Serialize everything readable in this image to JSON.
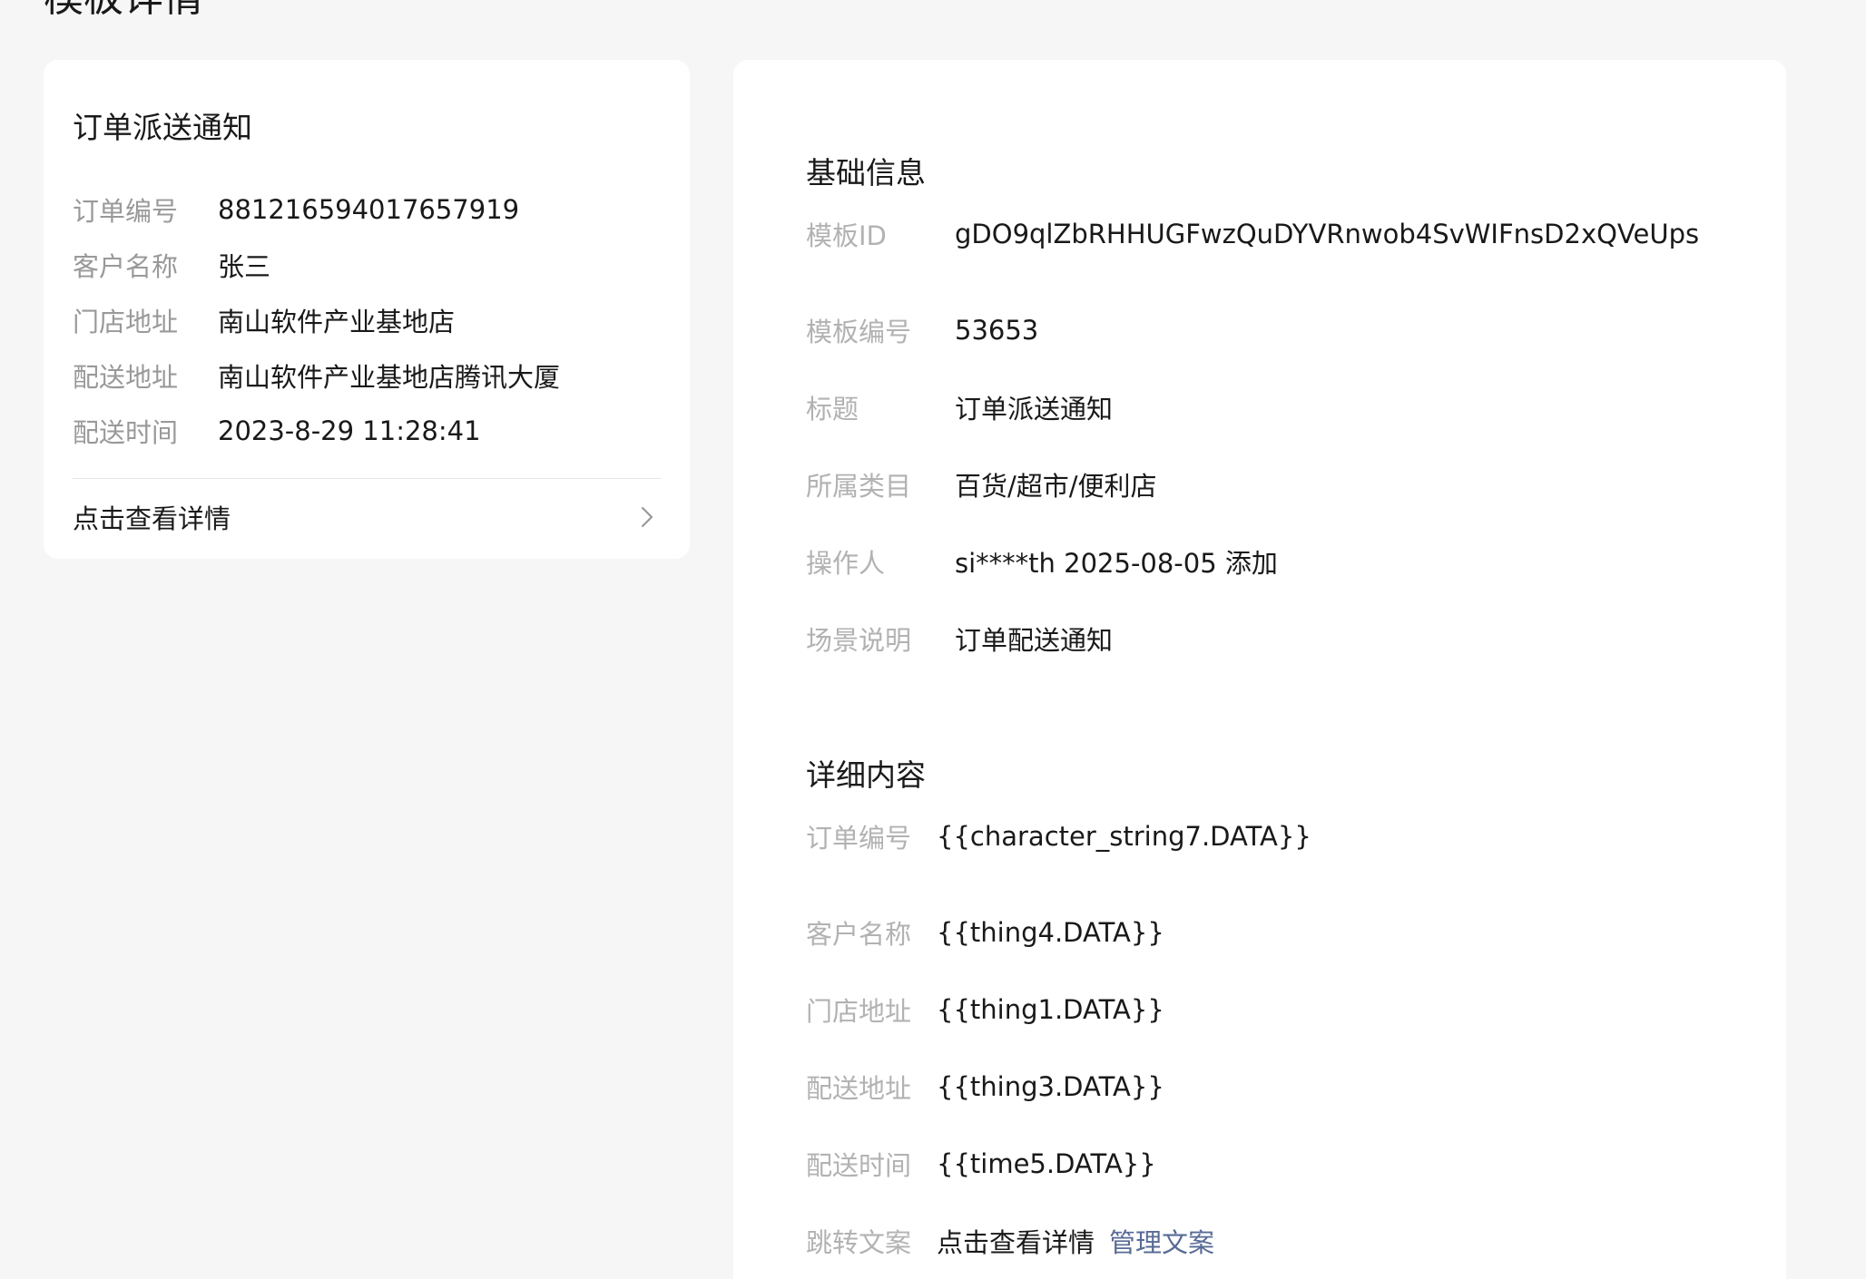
{
  "page": {
    "title": "模板详情"
  },
  "preview": {
    "title": "订单派送通知",
    "rows": [
      {
        "label": "订单编号",
        "value": "881216594017657919"
      },
      {
        "label": "客户名称",
        "value": "张三"
      },
      {
        "label": "门店地址",
        "value": "南山软件产业基地店"
      },
      {
        "label": "配送地址",
        "value": "南山软件产业基地店腾讯大厦"
      },
      {
        "label": "配送时间",
        "value": "2023-8-29 11:28:41"
      }
    ],
    "link_label": "点击查看详情",
    "link_icon": "chevron-right-icon"
  },
  "basic_info": {
    "title": "基础信息",
    "rows": [
      {
        "label": "模板ID",
        "value": "gDO9qlZbRHHUGFwzQuDYVRnwob4SvWIFnsD2xQVeUps"
      },
      {
        "label": "模板编号",
        "value": "53653"
      },
      {
        "label": "标题",
        "value": "订单派送通知"
      },
      {
        "label": "所属类目",
        "value": "百货/超市/便利店"
      },
      {
        "label": "操作人",
        "value": "si****th 2025-08-05 添加"
      },
      {
        "label": "场景说明",
        "value": "订单配送通知"
      }
    ]
  },
  "detail_content": {
    "title": "详细内容",
    "rows": [
      {
        "label": "订单编号",
        "value": "{{character_string7.DATA}}"
      },
      {
        "label": "客户名称",
        "value": "{{thing4.DATA}}"
      },
      {
        "label": "门店地址",
        "value": "{{thing1.DATA}}"
      },
      {
        "label": "配送地址",
        "value": "{{thing3.DATA}}"
      },
      {
        "label": "配送时间",
        "value": "{{time5.DATA}}"
      },
      {
        "label": "跳转文案",
        "value": "点击查看详情",
        "link": "管理文案"
      }
    ]
  },
  "colors": {
    "background": "#f6f6f6",
    "card": "#ffffff",
    "label_gray": "#b2b2b2",
    "text_dark": "#191919",
    "link_blue": "#576b95"
  }
}
